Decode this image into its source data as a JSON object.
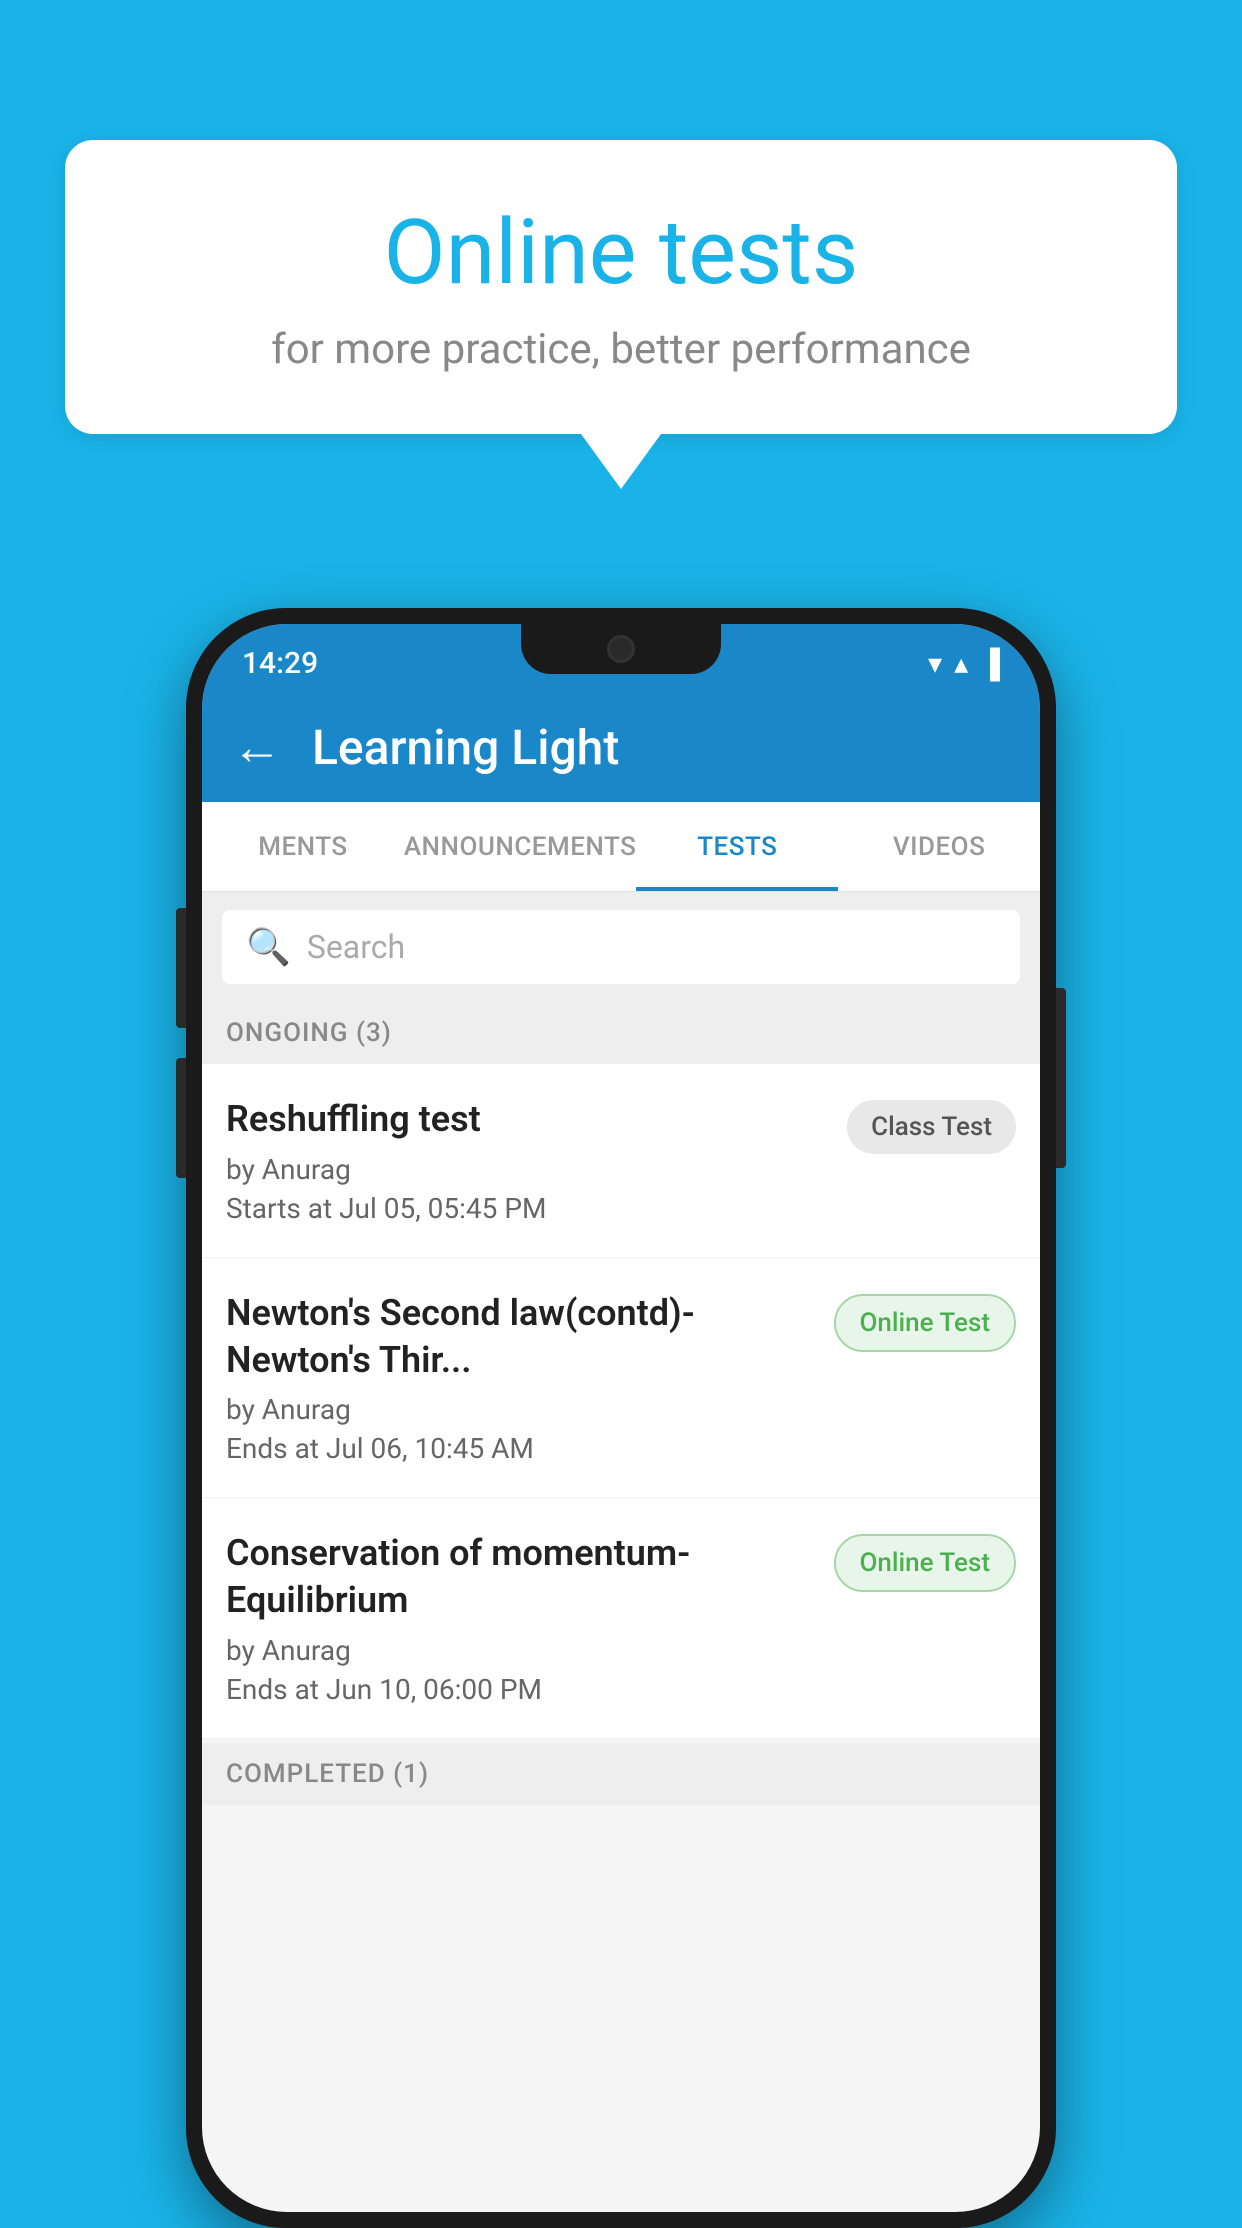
{
  "background_color": "#1ab3e8",
  "bubble": {
    "title": "Online tests",
    "subtitle": "for more practice, better performance"
  },
  "phone": {
    "status_bar": {
      "time": "14:29",
      "wifi": "▼",
      "signal": "▲",
      "battery": "▐"
    },
    "app_bar": {
      "title": "Learning Light",
      "back_label": "←"
    },
    "tabs": [
      {
        "label": "MENTS",
        "active": false
      },
      {
        "label": "ANNOUNCEMENTS",
        "active": false
      },
      {
        "label": "TESTS",
        "active": true
      },
      {
        "label": "VIDEOS",
        "active": false
      }
    ],
    "search": {
      "placeholder": "Search"
    },
    "ongoing_section": {
      "label": "ONGOING (3)"
    },
    "tests": [
      {
        "name": "Reshuffling test",
        "author": "by Anurag",
        "date_label": "Starts at",
        "date": "Jul 05, 05:45 PM",
        "badge": "Class Test",
        "badge_type": "class"
      },
      {
        "name": "Newton's Second law(contd)-Newton's Thir...",
        "author": "by Anurag",
        "date_label": "Ends at",
        "date": "Jul 06, 10:45 AM",
        "badge": "Online Test",
        "badge_type": "online"
      },
      {
        "name": "Conservation of momentum-Equilibrium",
        "author": "by Anurag",
        "date_label": "Ends at",
        "date": "Jun 10, 06:00 PM",
        "badge": "Online Test",
        "badge_type": "online"
      }
    ],
    "completed_section": {
      "label": "COMPLETED (1)"
    }
  }
}
